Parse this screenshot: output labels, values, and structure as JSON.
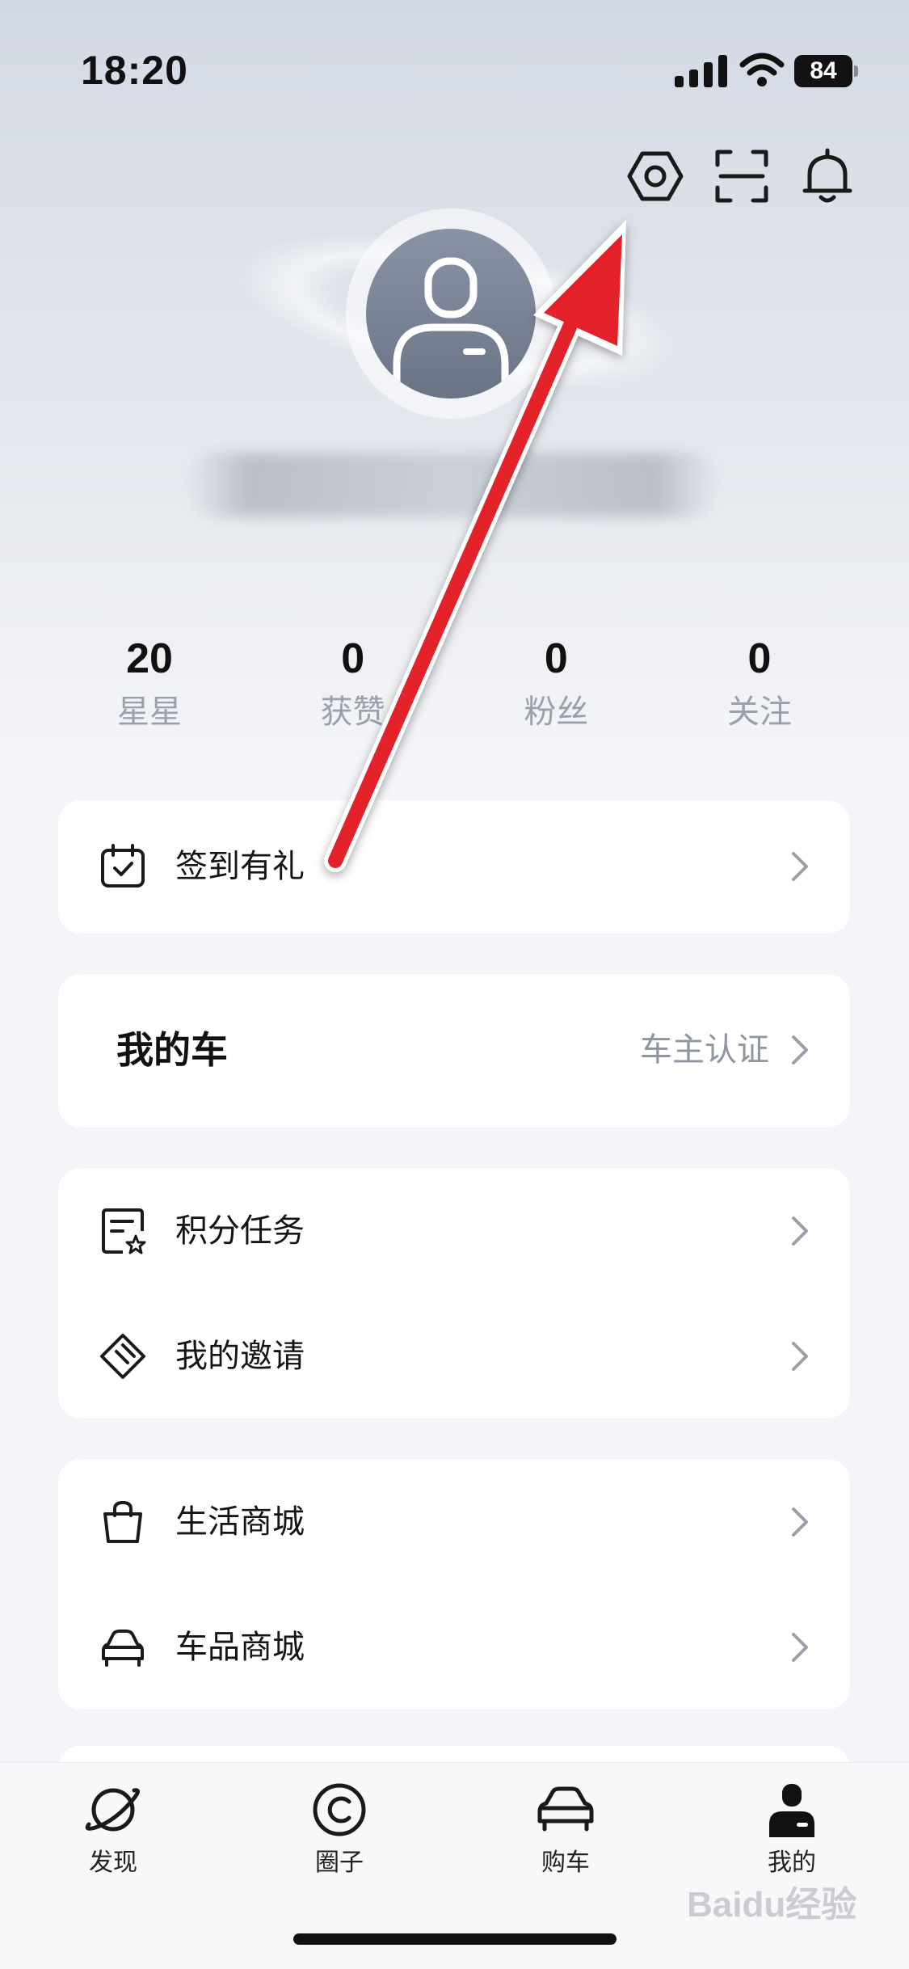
{
  "status_bar": {
    "time": "18:20",
    "battery": "84"
  },
  "top_icons": [
    "settings-icon",
    "scan-icon",
    "bell-icon"
  ],
  "stats": [
    {
      "value": "20",
      "label": "星星"
    },
    {
      "value": "0",
      "label": "获赞"
    },
    {
      "value": "0",
      "label": "粉丝"
    },
    {
      "value": "0",
      "label": "关注"
    }
  ],
  "signin": {
    "label": "签到有礼",
    "icon": "calendar-check-icon"
  },
  "my_car": {
    "title": "我的车",
    "action": "车主认证"
  },
  "tasks": [
    {
      "label": "积分任务",
      "icon": "task-list-icon"
    },
    {
      "label": "我的邀请",
      "icon": "ticket-icon"
    }
  ],
  "shops": [
    {
      "label": "生活商城",
      "icon": "shopping-bag-icon"
    },
    {
      "label": "车品商城",
      "icon": "car-icon"
    }
  ],
  "bottom_nav": [
    {
      "label": "发现",
      "icon": "planet-icon"
    },
    {
      "label": "圈子",
      "icon": "circle-icon"
    },
    {
      "label": "购车",
      "icon": "car-icon"
    },
    {
      "label": "我的",
      "icon": "profile-icon",
      "active": true
    }
  ],
  "watermark": "Baidu经验",
  "colors": {
    "arrow": "#e3202a",
    "muted_text": "#9aa0ab",
    "card_bg": "#ffffff",
    "page_bg": "#f4f5f8"
  }
}
